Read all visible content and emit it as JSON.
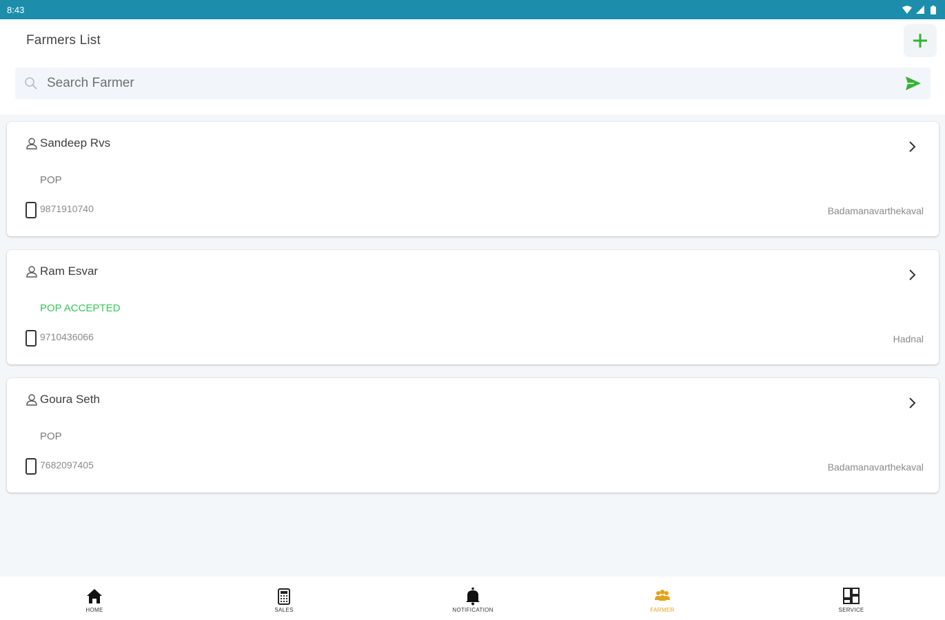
{
  "status_bar": {
    "time": "8:43"
  },
  "header": {
    "title": "Farmers List",
    "add_icon": "plus-icon"
  },
  "search": {
    "placeholder": "Search Farmer",
    "value": ""
  },
  "farmers": [
    {
      "name": "Sandeep Rvs",
      "status": "POP",
      "phone": "9871910740",
      "location": "Badamanavarthekaval"
    },
    {
      "name": "Ram Esvar",
      "status": "POP ACCEPTED",
      "phone": "9710436066",
      "location": "Hadnal"
    },
    {
      "name": "Goura Seth",
      "status": "POP",
      "phone": "7682097405",
      "location": "Badamanavarthekaval"
    }
  ],
  "bottom_nav": {
    "items": [
      {
        "label": "HOME",
        "icon": "home-icon"
      },
      {
        "label": "SALES",
        "icon": "sales-icon"
      },
      {
        "label": "NOTIFICATION",
        "icon": "bell-icon"
      },
      {
        "label": "FARMER",
        "icon": "farmers-icon",
        "active": true
      },
      {
        "label": "SERVICE",
        "icon": "service-icon"
      }
    ]
  },
  "colors": {
    "status_bar": "#1c8eac",
    "accent_green": "#34b233",
    "accepted_green": "#34c759",
    "active_nav": "#e3a21a",
    "background": "#f4f7fa"
  }
}
